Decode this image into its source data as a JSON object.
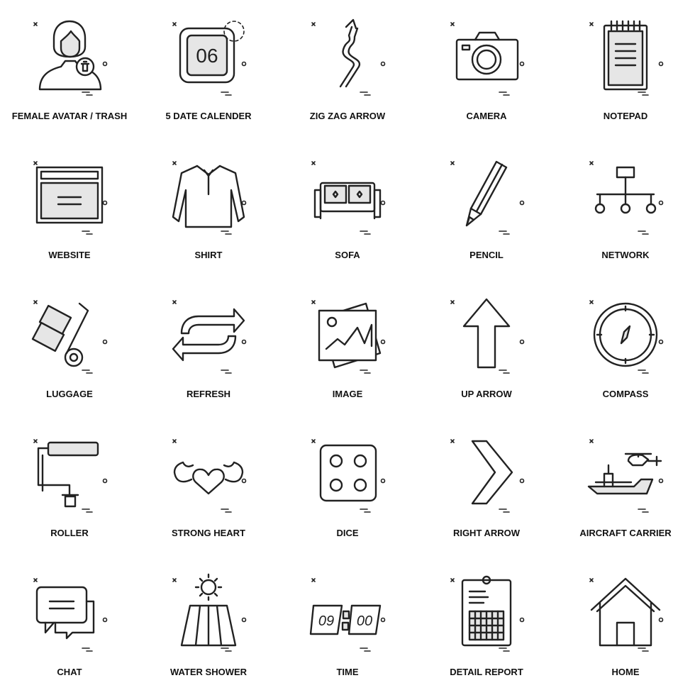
{
  "icons": [
    {
      "label": "FEMALE AVATAR / TRASH",
      "icon": "female-avatar-trash"
    },
    {
      "label": "5 DATE CALENDER",
      "icon": "calendar",
      "text": "06"
    },
    {
      "label": "ZIG ZAG ARROW",
      "icon": "zigzag-arrow"
    },
    {
      "label": "CAMERA",
      "icon": "camera"
    },
    {
      "label": "NOTEPAD",
      "icon": "notepad"
    },
    {
      "label": "WEBSITE",
      "icon": "website"
    },
    {
      "label": "SHIRT",
      "icon": "shirt"
    },
    {
      "label": "SOFA",
      "icon": "sofa"
    },
    {
      "label": "PENCIL",
      "icon": "pencil"
    },
    {
      "label": "NETWORK",
      "icon": "network"
    },
    {
      "label": "LUGGAGE",
      "icon": "luggage"
    },
    {
      "label": "REFRESH",
      "icon": "refresh"
    },
    {
      "label": "IMAGE",
      "icon": "image"
    },
    {
      "label": "UP ARROW",
      "icon": "up-arrow"
    },
    {
      "label": "COMPASS",
      "icon": "compass"
    },
    {
      "label": "ROLLER",
      "icon": "roller"
    },
    {
      "label": "STRONG HEART",
      "icon": "strong-heart"
    },
    {
      "label": "DICE",
      "icon": "dice"
    },
    {
      "label": "RIGHT ARROW",
      "icon": "right-arrow"
    },
    {
      "label": "AIRCRAFT CARRIER",
      "icon": "aircraft-carrier"
    },
    {
      "label": "CHAT",
      "icon": "chat"
    },
    {
      "label": "WATER SHOWER",
      "icon": "water-shower"
    },
    {
      "label": "TIME",
      "icon": "time",
      "hours": "09",
      "minutes": "00"
    },
    {
      "label": "DETAIL REPORT",
      "icon": "detail-report"
    },
    {
      "label": "HOME",
      "icon": "home"
    }
  ]
}
